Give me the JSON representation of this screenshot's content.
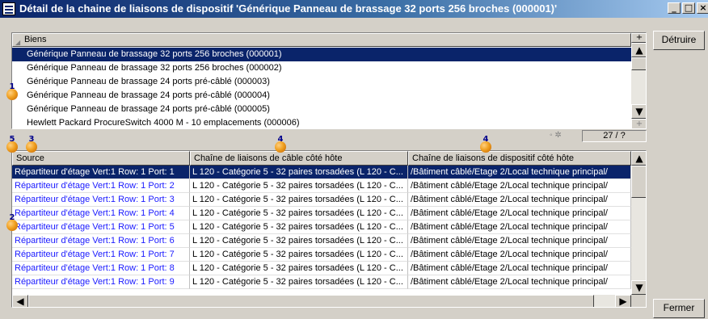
{
  "window": {
    "title": "Détail de la chaine de liaisons de dispositif 'Générique Panneau de brassage 32 ports 256 broches (000001)'",
    "minimize_glyph": "_",
    "maximize_glyph": "□",
    "close_glyph": "×"
  },
  "buttons": {
    "detruire": "Détruire",
    "fermer": "Fermer"
  },
  "assets_list": {
    "header": "Biens",
    "rows": [
      "Générique Panneau de brassage 32 ports 256 broches (000001)",
      "Générique Panneau de brassage 32 ports 256 broches (000002)",
      "Générique Panneau de brassage 24 ports pré-câblé (000003)",
      "Générique Panneau de brassage 24 ports pré-câblé (000004)",
      "Générique Panneau de brassage 24 ports pré-câblé (000005)",
      "Hewlett Packard ProcureSwitch 4000 M - 10 emplacements (000006)"
    ],
    "selected_index": 0,
    "count": "27 / ?"
  },
  "links_grid": {
    "columns": [
      "Source",
      "Chaîne de liaisons de câble côté hôte",
      "Chaîne de liaisons de dispositif côté hôte"
    ],
    "rows": [
      [
        "Répartiteur d'étage Vert:1 Row: 1 Port: 1",
        "L 120 - Catégorie 5 - 32 paires torsadées (L 120 - C...",
        "/Bâtiment câblé/Etage 2/Local technique principal/"
      ],
      [
        "Répartiteur d'étage Vert:1 Row: 1 Port: 2",
        "L 120 - Catégorie 5 - 32 paires torsadées (L 120 - C...",
        "/Bâtiment câblé/Etage 2/Local technique principal/"
      ],
      [
        "Répartiteur d'étage Vert:1 Row: 1 Port: 3",
        "L 120 - Catégorie 5 - 32 paires torsadées (L 120 - C...",
        "/Bâtiment câblé/Etage 2/Local technique principal/"
      ],
      [
        "Répartiteur d'étage Vert:1 Row: 1 Port: 4",
        "L 120 - Catégorie 5 - 32 paires torsadées (L 120 - C...",
        "/Bâtiment câblé/Etage 2/Local technique principal/"
      ],
      [
        "Répartiteur d'étage Vert:1 Row: 1 Port: 5",
        "L 120 - Catégorie 5 - 32 paires torsadées (L 120 - C...",
        "/Bâtiment câblé/Etage 2/Local technique principal/"
      ],
      [
        "Répartiteur d'étage Vert:1 Row: 1 Port: 6",
        "L 120 - Catégorie 5 - 32 paires torsadées (L 120 - C...",
        "/Bâtiment câblé/Etage 2/Local technique principal/"
      ],
      [
        "Répartiteur d'étage Vert:1 Row: 1 Port: 7",
        "L 120 - Catégorie 5 - 32 paires torsadées (L 120 - C...",
        "/Bâtiment câblé/Etage 2/Local technique principal/"
      ],
      [
        "Répartiteur d'étage Vert:1 Row: 1 Port: 8",
        "L 120 - Catégorie 5 - 32 paires torsadées (L 120 - C...",
        "/Bâtiment câblé/Etage 2/Local technique principal/"
      ],
      [
        "Répartiteur d'étage Vert:1 Row: 1 Port: 9",
        "L 120 - Catégorie 5 - 32 paires torsadées (L 120 - C...",
        "/Bâtiment câblé/Etage 2/Local technique principal/"
      ]
    ],
    "selected_index": 0
  },
  "callouts": {
    "assets_list": "1",
    "grid": "2",
    "source_column": "3",
    "cable_column": "4",
    "device_column": "4",
    "first_column": "5"
  },
  "colors": {
    "selection": "#0a246a",
    "link_text": "#1a1aff",
    "title_gradient_start": "#0a246a",
    "title_gradient_end": "#a6caf0"
  }
}
